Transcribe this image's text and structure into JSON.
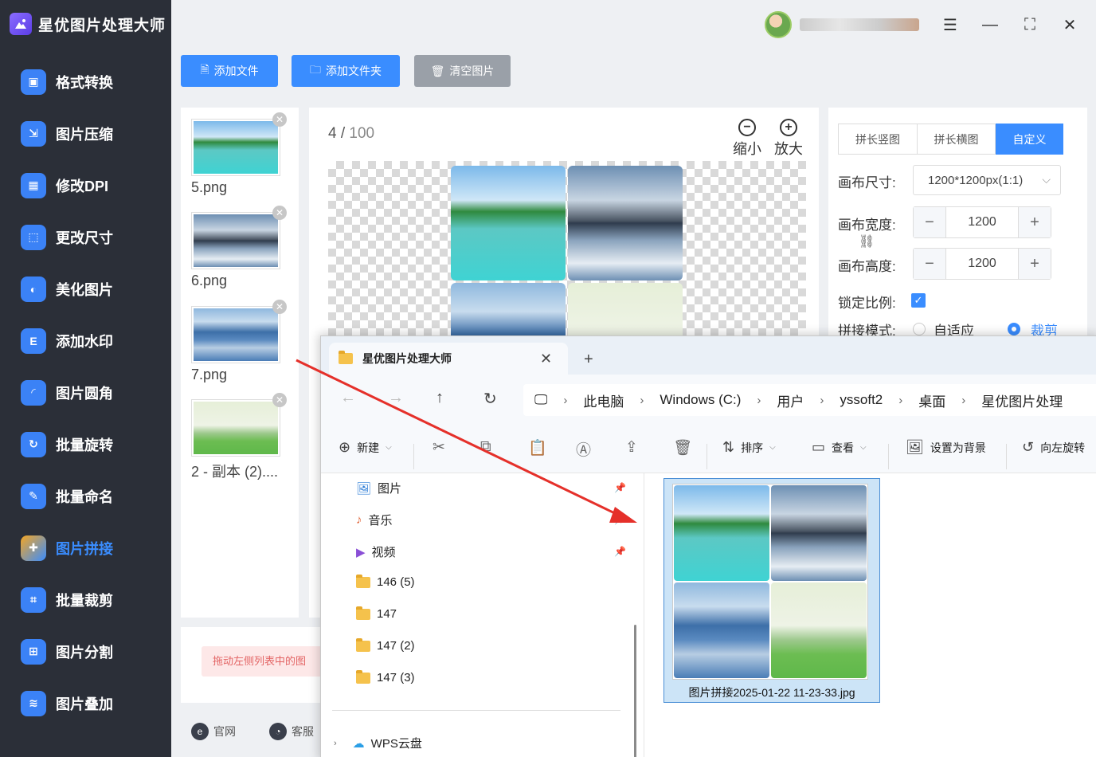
{
  "app": {
    "title": "星优图片处理大师"
  },
  "sidebar": {
    "items": [
      {
        "label": "格式转换",
        "icon": "image-convert-icon"
      },
      {
        "label": "图片压缩",
        "icon": "compress-icon"
      },
      {
        "label": "修改DPI",
        "icon": "dpi-icon"
      },
      {
        "label": "更改尺寸",
        "icon": "resize-icon"
      },
      {
        "label": "美化图片",
        "icon": "beautify-icon"
      },
      {
        "label": "添加水印",
        "icon": "watermark-icon"
      },
      {
        "label": "图片圆角",
        "icon": "round-corner-icon"
      },
      {
        "label": "批量旋转",
        "icon": "rotate-icon"
      },
      {
        "label": "批量命名",
        "icon": "rename-icon"
      },
      {
        "label": "图片拼接",
        "icon": "stitch-icon",
        "active": true
      },
      {
        "label": "批量裁剪",
        "icon": "crop-icon"
      },
      {
        "label": "图片分割",
        "icon": "split-icon"
      },
      {
        "label": "图片叠加",
        "icon": "overlay-icon"
      }
    ]
  },
  "toolbar": {
    "add_file": "添加文件",
    "add_folder": "添加文件夹",
    "clear": "清空图片"
  },
  "thumbnails": [
    {
      "label": "5.png"
    },
    {
      "label": "6.png"
    },
    {
      "label": "7.png"
    },
    {
      "label": "2 - 副本 (2)...."
    }
  ],
  "preview": {
    "current": "4",
    "total": "100",
    "zoom_out": "缩小",
    "zoom_in": "放大"
  },
  "settings": {
    "tabs": [
      "拼长竖图",
      "拼长横图",
      "自定义"
    ],
    "active_tab": "自定义",
    "canvas_size_label": "画布尺寸:",
    "canvas_size_value": "1200*1200px(1:1)",
    "width_label": "画布宽度:",
    "width_value": "1200",
    "height_label": "画布高度:",
    "height_value": "1200",
    "lock_label": "锁定比例:",
    "lock_checked": true,
    "mode_label": "拼接模式:",
    "mode_options": [
      "自适应",
      "裁剪"
    ],
    "mode_selected": "裁剪"
  },
  "hint": {
    "text": "拖动左侧列表中的图"
  },
  "footer": {
    "website": "官网",
    "service": "客服"
  },
  "explorer": {
    "tab_title": "星优图片处理大师",
    "breadcrumb": [
      "此电脑",
      "Windows (C:)",
      "用户",
      "yssoft2",
      "桌面",
      "星优图片处理"
    ],
    "commands": {
      "new": "新建",
      "sort": "排序",
      "view": "查看",
      "set_background": "设置为背景",
      "rotate_left": "向左旋转"
    },
    "tree": [
      {
        "label": "图片",
        "icon": "pictures-icon",
        "pinned": true
      },
      {
        "label": "音乐",
        "icon": "music-icon",
        "pinned": true
      },
      {
        "label": "视频",
        "icon": "video-icon",
        "pinned": true
      },
      {
        "label": "146 (5)",
        "icon": "folder-icon"
      },
      {
        "label": "147",
        "icon": "folder-icon"
      },
      {
        "label": "147 (2)",
        "icon": "folder-icon"
      },
      {
        "label": "147 (3)",
        "icon": "folder-icon"
      }
    ],
    "cloud": "WPS云盘",
    "file_name": "图片拼接2025-01-22 11-23-33.jpg"
  },
  "colors": {
    "accent": "#3a8dff",
    "sidebar_bg": "#2b2f38",
    "arrow": "#e5302a"
  }
}
